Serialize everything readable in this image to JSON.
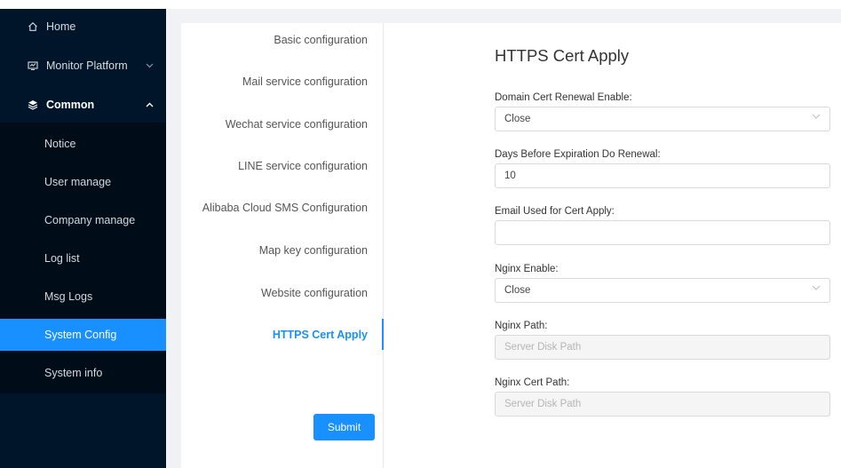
{
  "sidebar": {
    "home": {
      "label": "Home",
      "icon": "home-icon"
    },
    "monitor": {
      "label": "Monitor Platform",
      "icon": "monitor-icon",
      "chevron": "chevron-down-icon"
    },
    "common": {
      "label": "Common",
      "icon": "layers-icon",
      "chevron": "chevron-up-icon"
    },
    "items": [
      {
        "label": "Notice"
      },
      {
        "label": "User manage"
      },
      {
        "label": "Company manage"
      },
      {
        "label": "Log list"
      },
      {
        "label": "Msg Logs"
      },
      {
        "label": "System Config",
        "active": true
      },
      {
        "label": "System info"
      }
    ]
  },
  "tabs": [
    {
      "label": "Basic configuration"
    },
    {
      "label": "Mail service configuration"
    },
    {
      "label": "Wechat service configuration"
    },
    {
      "label": "LINE service configuration"
    },
    {
      "label": "Alibaba Cloud SMS Configuration"
    },
    {
      "label": "Map key configuration"
    },
    {
      "label": "Website configuration"
    },
    {
      "label": "HTTPS Cert Apply",
      "active": true
    }
  ],
  "form": {
    "title": "HTTPS Cert Apply",
    "renewal_enable": {
      "label": "Domain Cert Renewal Enable:",
      "value": "Close"
    },
    "days_before": {
      "label": "Days Before Expiration Do Renewal:",
      "value": "10"
    },
    "email": {
      "label": "Email Used for Cert Apply:",
      "value": ""
    },
    "nginx_enable": {
      "label": "Nginx Enable:",
      "value": "Close"
    },
    "nginx_path": {
      "label": "Nginx Path:",
      "placeholder": "Server Disk Path"
    },
    "nginx_cert_path": {
      "label": "Nginx Cert Path:",
      "placeholder": "Server Disk Path"
    },
    "submit_label": "Submit"
  },
  "colors": {
    "sidebar_bg": "#001529",
    "submenu_bg": "#000c17",
    "accent": "#1890ff"
  }
}
